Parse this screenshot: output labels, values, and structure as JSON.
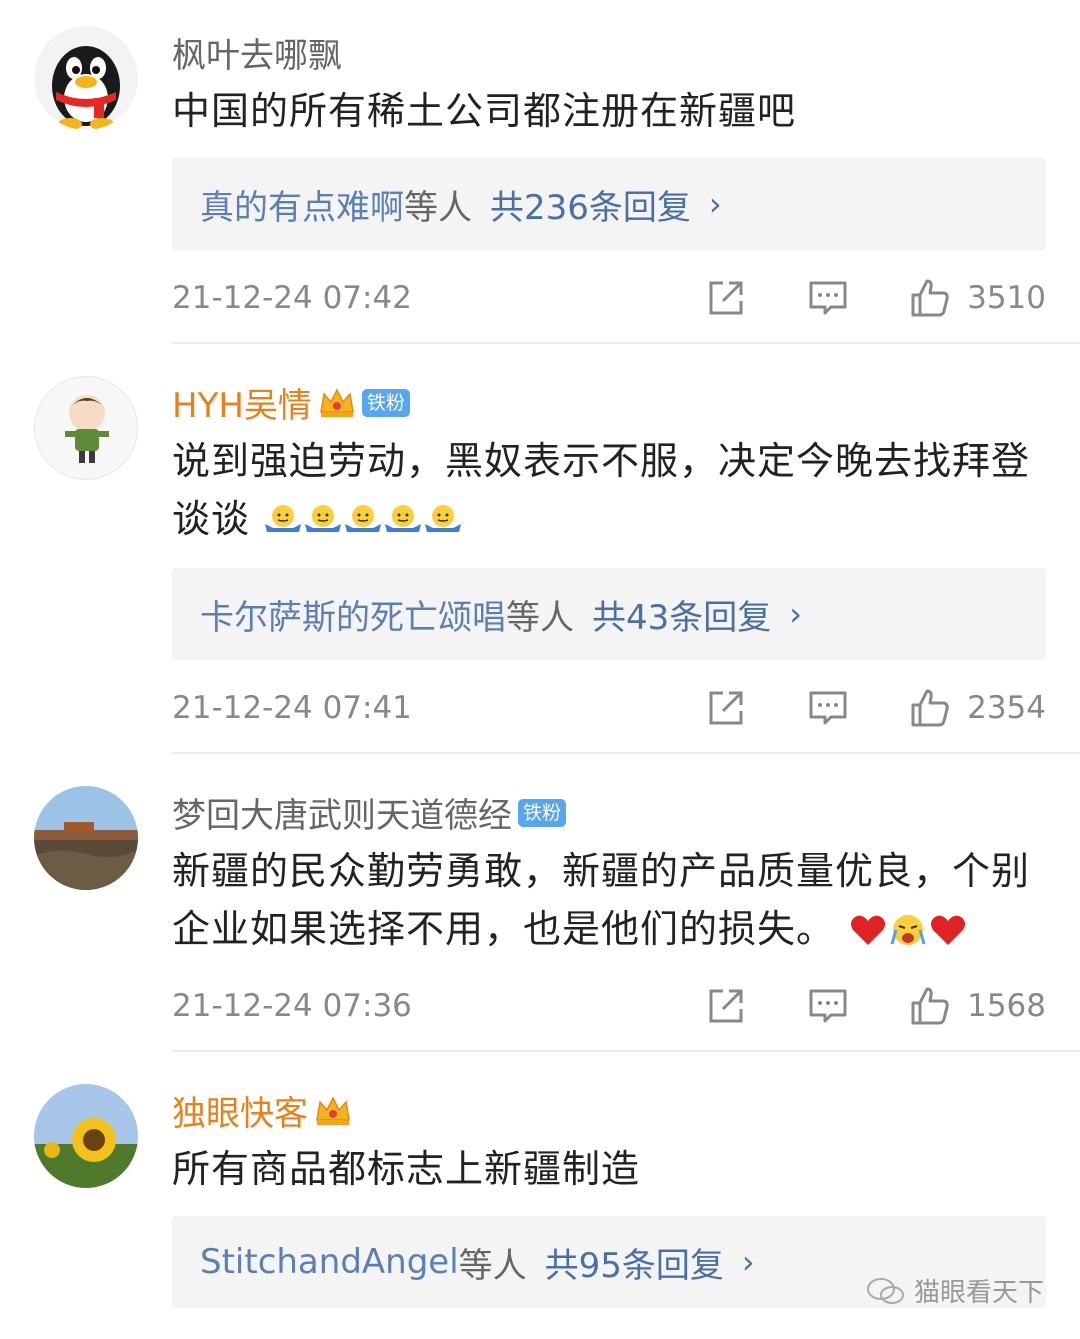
{
  "comments": [
    {
      "username": "枫叶去哪飘",
      "text": "中国的所有稀土公司都注册在新疆吧",
      "reply_names": "真的有点难啊",
      "reply_suffix": "等人",
      "reply_count": "共236条回复",
      "time": "21-12-24 07:42",
      "likes": "3510"
    },
    {
      "username": "HYH吴情",
      "badge": "铁粉",
      "text": "说到强迫劳动，黑奴表示不服，决定今晚去找拜登谈谈",
      "reply_names": "卡尔萨斯的死亡颂唱",
      "reply_suffix": "等人",
      "reply_count": "共43条回复",
      "time": "21-12-24 07:41",
      "likes": "2354"
    },
    {
      "username": "梦回大唐武则天道德经",
      "badge": "铁粉",
      "text": "新疆的民众勤劳勇敢，新疆的产品质量优良，个别企业如果选择不用，也是他们的损失。",
      "time": "21-12-24 07:36",
      "likes": "1568"
    },
    {
      "username": "独眼快客",
      "text": "所有商品都标志上新疆制造",
      "reply_names": "StitchandAngel",
      "reply_suffix": "等人",
      "reply_count": "共95条回复"
    }
  ],
  "watermark": "猫眼看天下",
  "icons": [
    "share-icon",
    "comment-icon",
    "like-icon",
    "chevron-right-icon",
    "crown-icon",
    "shrug-emoji-icon",
    "heart-icon",
    "crying-emoji-icon"
  ]
}
